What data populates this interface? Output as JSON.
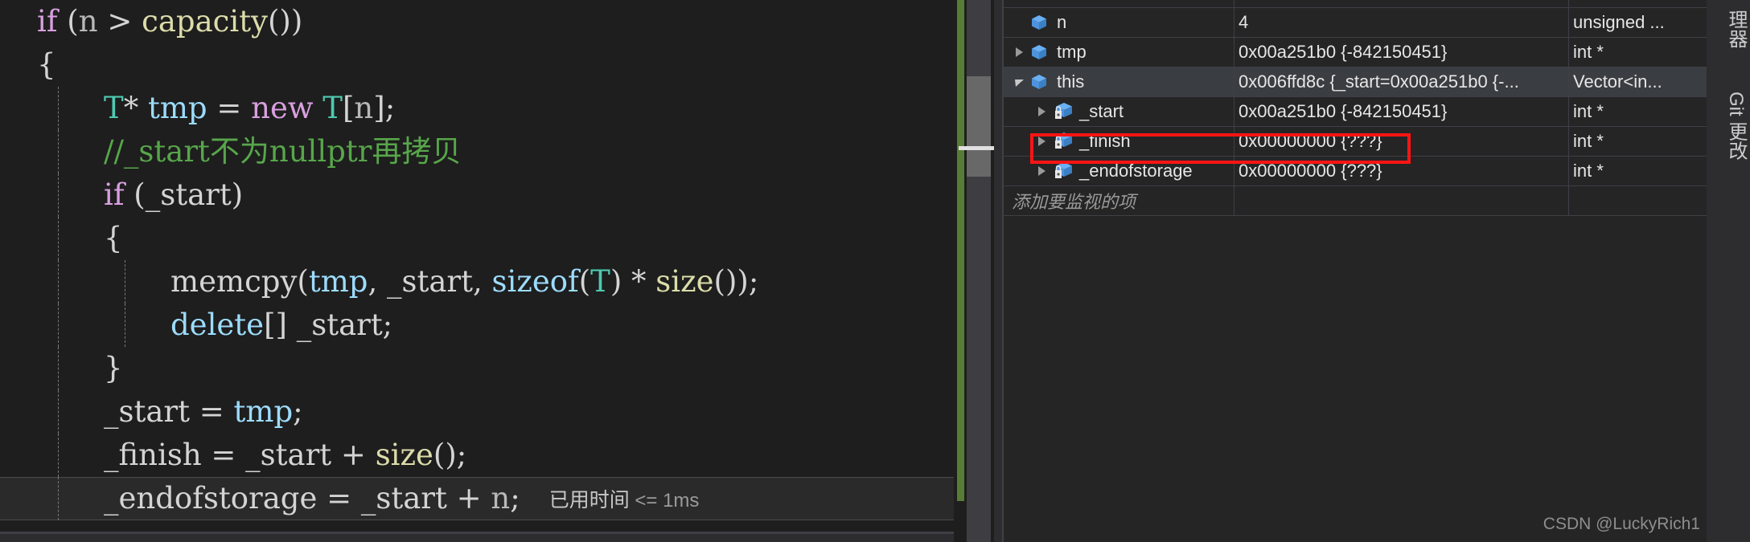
{
  "editor": {
    "lines": [
      {
        "indent": 0,
        "guides": [],
        "tokens": [
          {
            "t": "if",
            "c": "kw"
          },
          {
            "t": " ",
            "c": "pl"
          },
          {
            "t": "(",
            "c": "br"
          },
          {
            "t": "n",
            "c": "dim"
          },
          {
            "t": " > ",
            "c": "pl"
          },
          {
            "t": "capacity",
            "c": "fn"
          },
          {
            "t": "())",
            "c": "br"
          }
        ]
      },
      {
        "indent": 0,
        "guides": [],
        "tokens": [
          {
            "t": "{",
            "c": "br"
          }
        ]
      },
      {
        "indent": 1,
        "guides": [
          "g1"
        ],
        "tokens": [
          {
            "t": "T",
            "c": "type"
          },
          {
            "t": "* ",
            "c": "pl"
          },
          {
            "t": "tmp",
            "c": "id"
          },
          {
            "t": " = ",
            "c": "pl"
          },
          {
            "t": "new",
            "c": "kw"
          },
          {
            "t": " ",
            "c": "pl"
          },
          {
            "t": "T",
            "c": "type"
          },
          {
            "t": "[",
            "c": "br"
          },
          {
            "t": "n",
            "c": "dim"
          },
          {
            "t": "];",
            "c": "br"
          }
        ]
      },
      {
        "indent": 1,
        "guides": [
          "g1"
        ],
        "tokens": [
          {
            "t": "//_start不为nullptr再拷贝",
            "c": "cm"
          }
        ]
      },
      {
        "indent": 1,
        "guides": [
          "g1"
        ],
        "tokens": [
          {
            "t": "if",
            "c": "kw"
          },
          {
            "t": " ",
            "c": "pl"
          },
          {
            "t": "(",
            "c": "br"
          },
          {
            "t": "_start",
            "c": "pl"
          },
          {
            "t": ")",
            "c": "br"
          }
        ]
      },
      {
        "indent": 1,
        "guides": [
          "g1"
        ],
        "tokens": [
          {
            "t": "{",
            "c": "br"
          }
        ]
      },
      {
        "indent": 2,
        "guides": [
          "g1",
          "g2"
        ],
        "tokens": [
          {
            "t": "memcpy",
            "c": "pl"
          },
          {
            "t": "(",
            "c": "br"
          },
          {
            "t": "tmp",
            "c": "id"
          },
          {
            "t": ", ",
            "c": "pl"
          },
          {
            "t": "_start",
            "c": "pl"
          },
          {
            "t": ", ",
            "c": "pl"
          },
          {
            "t": "sizeof",
            "c": "id"
          },
          {
            "t": "(",
            "c": "br"
          },
          {
            "t": "T",
            "c": "type"
          },
          {
            "t": ") * ",
            "c": "pl"
          },
          {
            "t": "size",
            "c": "fn"
          },
          {
            "t": "());",
            "c": "br"
          }
        ]
      },
      {
        "indent": 2,
        "guides": [
          "g1",
          "g2"
        ],
        "tokens": [
          {
            "t": "delete",
            "c": "id"
          },
          {
            "t": "[]",
            "c": "br"
          },
          {
            "t": " _start;",
            "c": "pl"
          }
        ]
      },
      {
        "indent": 1,
        "guides": [
          "g1"
        ],
        "tokens": [
          {
            "t": "}",
            "c": "br"
          }
        ]
      },
      {
        "indent": 1,
        "guides": [
          "g1"
        ],
        "tokens": [
          {
            "t": "_start = ",
            "c": "pl"
          },
          {
            "t": "tmp",
            "c": "id"
          },
          {
            "t": ";",
            "c": "pl"
          }
        ]
      },
      {
        "indent": 1,
        "guides": [
          "g1"
        ],
        "tokens": [
          {
            "t": "_finish = _start + ",
            "c": "pl"
          },
          {
            "t": "size",
            "c": "fn"
          },
          {
            "t": "();",
            "c": "br"
          }
        ]
      },
      {
        "indent": 1,
        "guides": [
          "g1"
        ],
        "highlight": true,
        "tokens": [
          {
            "t": "_endofstorage = _start + ",
            "c": "pl"
          },
          {
            "t": "n",
            "c": "dim"
          },
          {
            "t": ";",
            "c": "pl"
          }
        ],
        "elapsed": "已用时间",
        "elapsed_value": "<= 1ms"
      }
    ]
  },
  "watch": {
    "rows": [
      {
        "clipped": true,
        "expander": "none",
        "icon": "",
        "indent": 1,
        "name": "",
        "value": "",
        "type": ""
      },
      {
        "expander": "none",
        "icon": "cube-icon",
        "indent": 1,
        "name": "n",
        "value": "4",
        "type": "unsigned ..."
      },
      {
        "expander": "collapsed",
        "icon": "cube-icon",
        "indent": 1,
        "name": "tmp",
        "value": "0x00a251b0 {-842150451}",
        "type": "int *"
      },
      {
        "expander": "expanded",
        "icon": "cube-icon",
        "indent": 1,
        "name": "this",
        "value": "0x006ffd8c {_start=0x00a251b0 {-...",
        "type": "Vector<in...",
        "selected": true
      },
      {
        "expander": "collapsed",
        "icon": "lock-cube-icon",
        "indent": 2,
        "name": "_start",
        "value": "0x00a251b0 {-842150451}",
        "type": "int *"
      },
      {
        "expander": "collapsed",
        "icon": "lock-cube-icon",
        "indent": 2,
        "name": "_finish",
        "value": "0x00000000 {???}",
        "type": "int *",
        "annotated": true
      },
      {
        "expander": "collapsed",
        "icon": "lock-cube-icon",
        "indent": 2,
        "name": "_endofstorage",
        "value": "0x00000000 {???}",
        "type": "int *"
      }
    ],
    "add_watch_placeholder": "添加要监视的项",
    "annotation_color": "#ff1414"
  },
  "right_tabs": [
    {
      "label": "理器"
    },
    {
      "label": "Git 更改"
    }
  ],
  "watermark": "CSDN @LuckyRich1"
}
